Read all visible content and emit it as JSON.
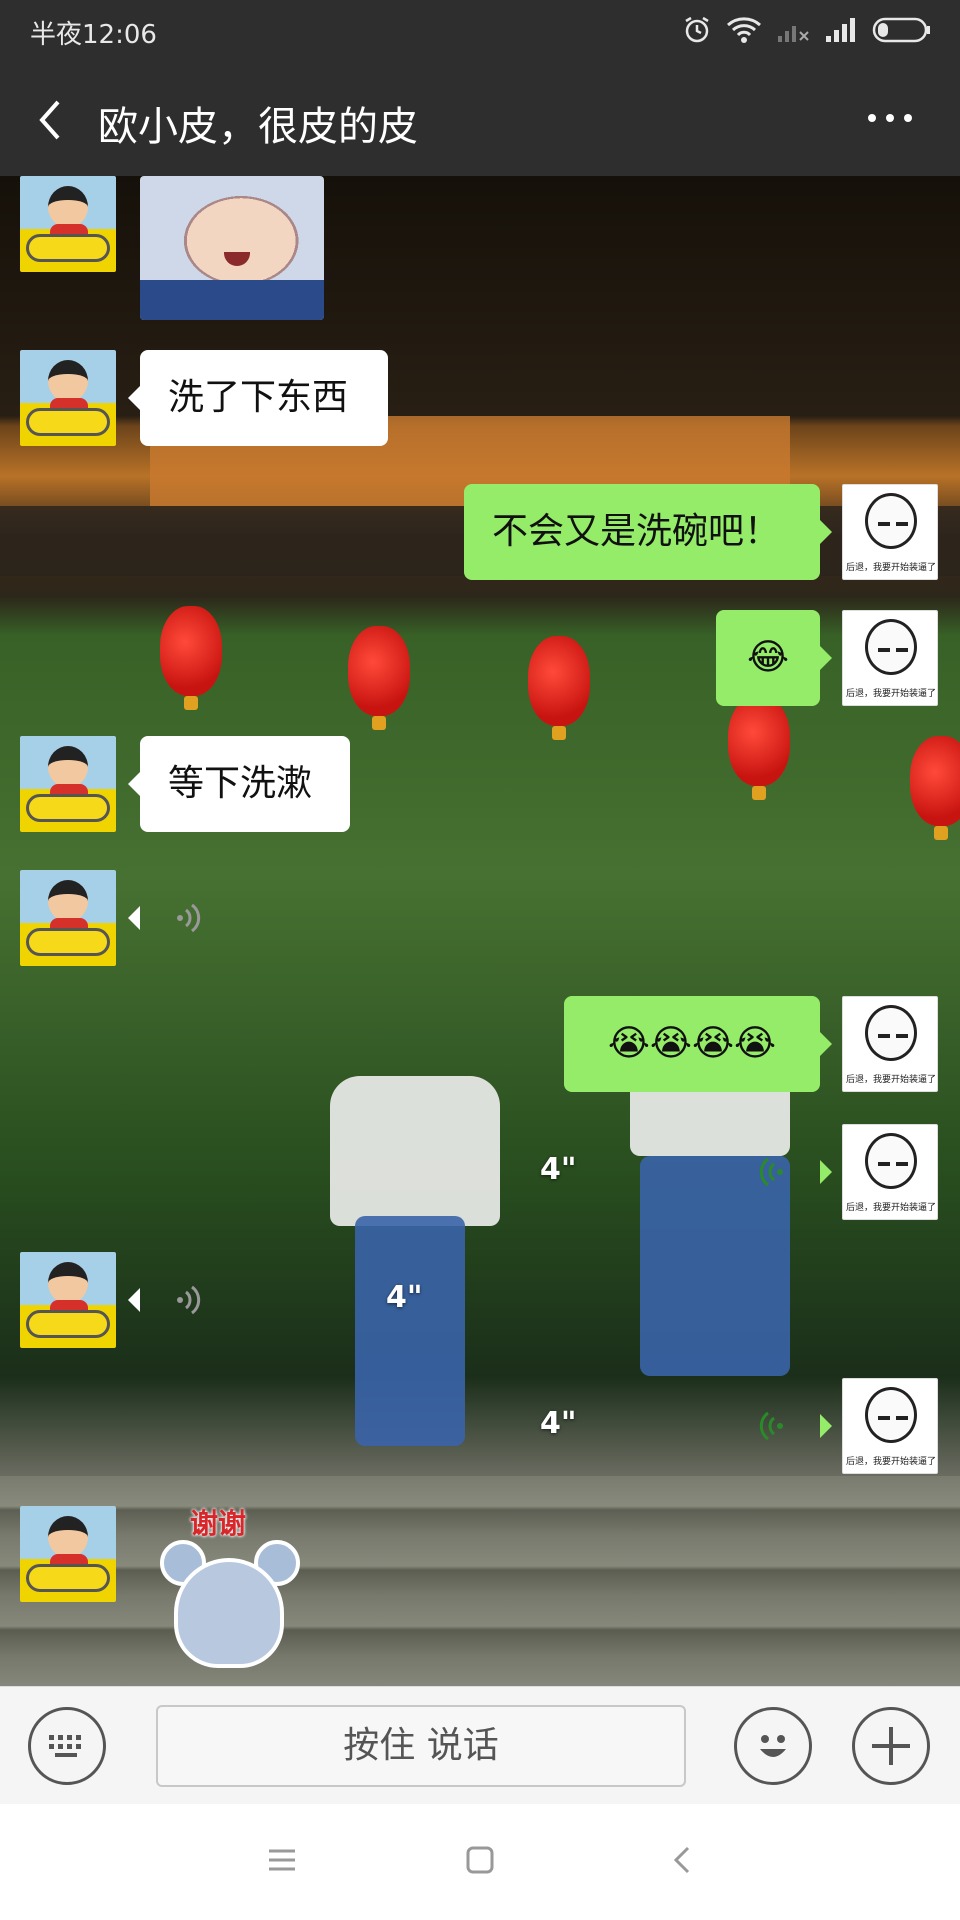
{
  "status_bar": {
    "time": "半夜12:06",
    "icons": [
      "alarm-icon",
      "wifi-icon",
      "signal-off-icon",
      "signal-icon",
      "battery-icon"
    ]
  },
  "header": {
    "title": "欧小皮，很皮的皮",
    "back_icon": "back-arrow-icon",
    "more_icon": "more-dots-icon"
  },
  "messages": [
    {
      "side": "left",
      "type": "sticker",
      "sticker": "crying-baby-sticker"
    },
    {
      "side": "left",
      "type": "text",
      "text": "洗了下东西"
    },
    {
      "side": "right",
      "type": "text",
      "text": "不会又是洗碗吧！"
    },
    {
      "side": "right",
      "type": "emoji",
      "text": "😂"
    },
    {
      "side": "left",
      "type": "text",
      "text": "等下洗漱"
    },
    {
      "side": "left",
      "type": "voice",
      "duration": ""
    },
    {
      "side": "right",
      "type": "emoji",
      "text": "😭😭😭😭"
    },
    {
      "side": "right",
      "type": "voice",
      "duration": "4\""
    },
    {
      "side": "left",
      "type": "voice",
      "duration": "4\""
    },
    {
      "side": "right",
      "type": "voice",
      "duration": "4\""
    },
    {
      "side": "left",
      "type": "sticker",
      "sticker": "mouse-thanks-sticker",
      "sticker_text": "谢谢"
    }
  ],
  "avatars": {
    "self_caption": "后退，我要开始装逼了"
  },
  "input_bar": {
    "talk_label": "按住 说话",
    "keyboard_icon": "keyboard-icon",
    "emoji_icon": "emoji-icon",
    "plus_icon": "plus-icon"
  },
  "nav_bar": {
    "icons": [
      "menu-icon",
      "home-icon",
      "back-icon"
    ]
  },
  "colors": {
    "header_bg": "#2e2e2e",
    "self_bubble": "#95ec69",
    "friend_bubble": "#ffffff"
  }
}
